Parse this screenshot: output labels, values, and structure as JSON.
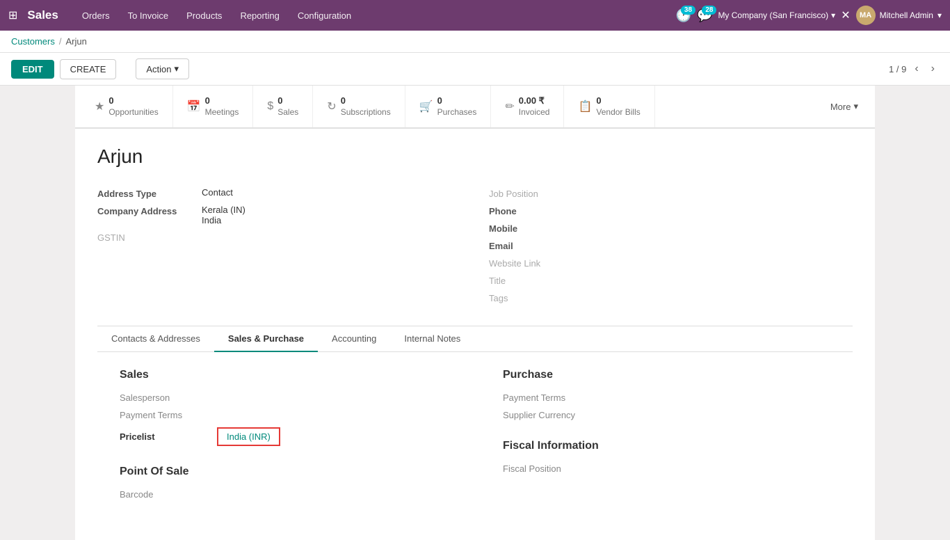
{
  "topnav": {
    "app_title": "Sales",
    "nav_items": [
      "Orders",
      "To Invoice",
      "Products",
      "Reporting",
      "Configuration"
    ],
    "notifications_count": "38",
    "messages_count": "28",
    "company": "My Company (San Francisco)",
    "user": "Mitchell Admin"
  },
  "breadcrumb": {
    "parent": "Customers",
    "current": "Arjun"
  },
  "toolbar": {
    "edit_label": "EDIT",
    "create_label": "CREATE",
    "action_label": "Action",
    "pagination": "1 / 9"
  },
  "stats": {
    "opportunities": {
      "count": "0",
      "label": "Opportunities"
    },
    "meetings": {
      "count": "0",
      "label": "Meetings"
    },
    "sales": {
      "count": "0",
      "label": "Sales"
    },
    "subscriptions": {
      "count": "0",
      "label": "Subscriptions"
    },
    "purchases": {
      "count": "0",
      "label": "Purchases"
    },
    "invoiced": {
      "count": "0.00 ₹",
      "label": "Invoiced"
    },
    "vendor_bills": {
      "count": "0",
      "label": "Vendor Bills"
    },
    "more_label": "More"
  },
  "customer": {
    "name": "Arjun",
    "address_type_label": "Address Type",
    "address_type_value": "Contact",
    "company_address_label": "Company Address",
    "company_address_value": "Kerala (IN)",
    "company_address_country": "India",
    "gstin_label": "GSTIN",
    "job_position_label": "Job Position",
    "phone_label": "Phone",
    "mobile_label": "Mobile",
    "email_label": "Email",
    "website_label": "Website Link",
    "title_label": "Title",
    "tags_label": "Tags"
  },
  "tabs": [
    {
      "id": "contacts",
      "label": "Contacts & Addresses",
      "active": false
    },
    {
      "id": "sales_purchase",
      "label": "Sales & Purchase",
      "active": true
    },
    {
      "id": "accounting",
      "label": "Accounting",
      "active": false
    },
    {
      "id": "internal_notes",
      "label": "Internal Notes",
      "active": false
    }
  ],
  "sales_purchase": {
    "sales_section": "Sales",
    "salesperson_label": "Salesperson",
    "payment_terms_label": "Payment Terms",
    "pricelist_label": "Pricelist",
    "pricelist_value": "India (INR)",
    "point_of_sale_section": "Point Of Sale",
    "barcode_label": "Barcode",
    "purchase_section": "Purchase",
    "purchase_payment_terms_label": "Payment Terms",
    "supplier_currency_label": "Supplier Currency",
    "fiscal_info_section": "Fiscal Information",
    "fiscal_position_label": "Fiscal Position"
  }
}
